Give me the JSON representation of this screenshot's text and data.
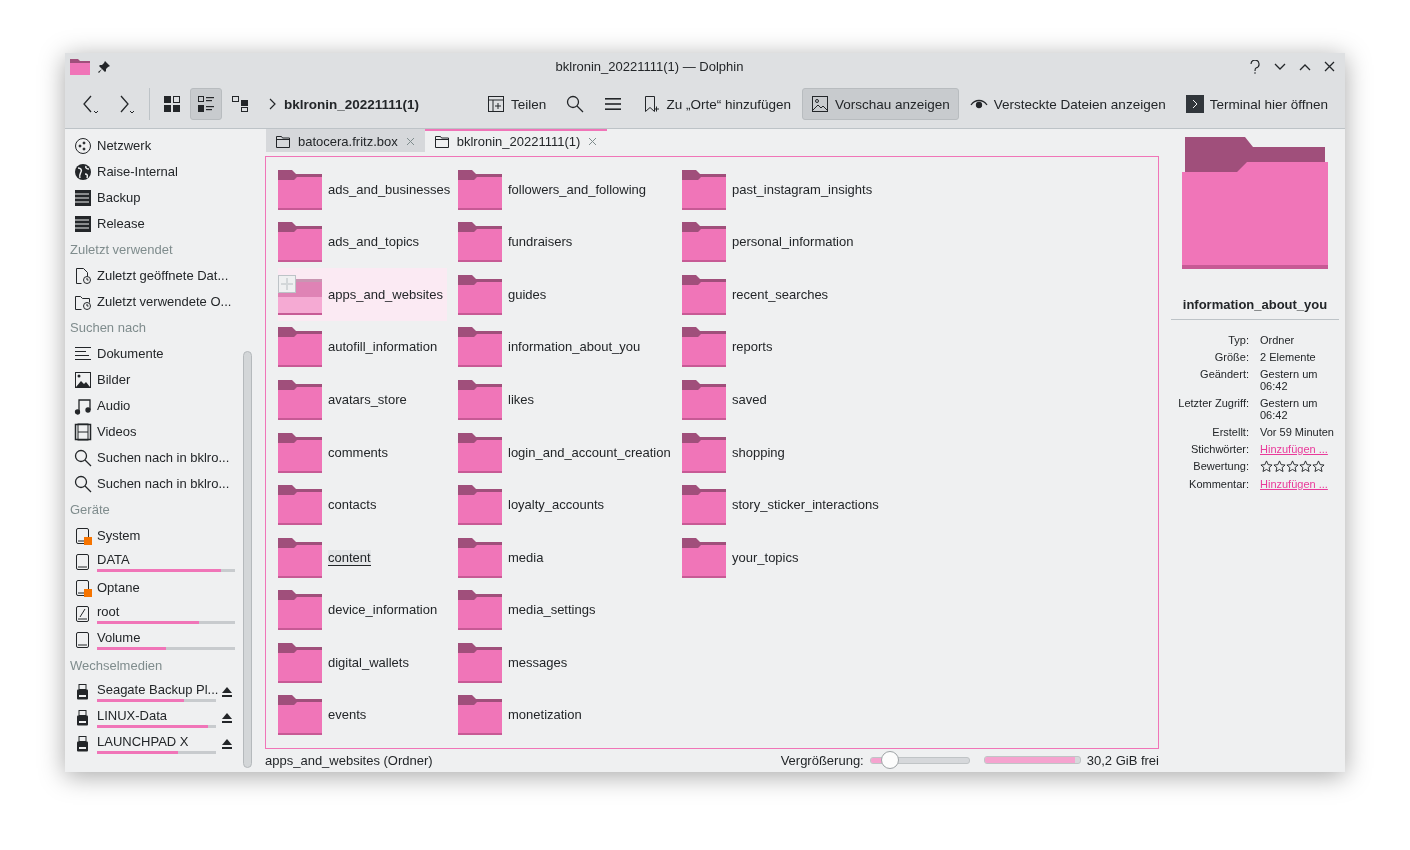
{
  "window": {
    "title": "bklronin_20221111(1) — Dolphin"
  },
  "toolbar": {
    "view_modes": [
      {
        "kind": "icons",
        "selected": false
      },
      {
        "kind": "compact",
        "selected": true
      },
      {
        "kind": "tree",
        "selected": false
      }
    ],
    "breadcrumb": "bklronin_20221111(1)",
    "actions": [
      {
        "kind": "share",
        "label": "Teilen"
      },
      {
        "kind": "search"
      },
      {
        "kind": "menu"
      },
      {
        "kind": "bookmark",
        "label": "Zu „Orte“ hinzufügen"
      },
      {
        "kind": "preview",
        "label": "Vorschau anzeigen",
        "checked": true
      },
      {
        "kind": "eye",
        "label": "Versteckte Dateien anzeigen",
        "checked": false
      },
      {
        "kind": "terminal",
        "label": "Terminal hier öffnen"
      }
    ]
  },
  "sidebar": {
    "sections": [
      {
        "items": [
          {
            "kind": "network",
            "label": "Netzwerk"
          },
          {
            "kind": "globe",
            "label": "Raise-Internal"
          },
          {
            "kind": "server",
            "label": "Backup"
          },
          {
            "kind": "server",
            "label": "Release"
          }
        ]
      },
      {
        "heading": "Zuletzt verwendet",
        "items": [
          {
            "kind": "recent-file",
            "label": "Zuletzt geöffnete Dat..."
          },
          {
            "kind": "recent-folder",
            "label": "Zuletzt verwendete O..."
          }
        ]
      },
      {
        "heading": "Suchen nach",
        "items": [
          {
            "kind": "document",
            "label": "Dokumente"
          },
          {
            "kind": "image",
            "label": "Bilder"
          },
          {
            "kind": "music",
            "label": "Audio"
          },
          {
            "kind": "film",
            "label": "Videos"
          },
          {
            "kind": "search",
            "label": "Suchen nach  in bklro..."
          },
          {
            "kind": "search",
            "label": "Suchen nach  in bklro..."
          }
        ]
      },
      {
        "heading": "Geräte",
        "items": [
          {
            "kind": "drive",
            "label": "System",
            "mounted": false
          },
          {
            "kind": "drive",
            "label": "DATA",
            "mounted": true,
            "level": 0.9
          },
          {
            "kind": "drive",
            "label": "Optane",
            "mounted": false
          },
          {
            "kind": "drive-root",
            "label": "root",
            "mounted": true,
            "level": 0.74
          },
          {
            "kind": "drive",
            "label": "Volume",
            "mounted": true,
            "level": 0.5
          }
        ]
      },
      {
        "heading": "Wechselmedien",
        "items": [
          {
            "kind": "usb",
            "label": "Seagate Backup Pl...",
            "level": 0.73,
            "ejectable": true
          },
          {
            "kind": "usb",
            "label": "LINUX-Data",
            "level": 0.93,
            "ejectable": true
          },
          {
            "kind": "usb",
            "label": "LAUNCHPAD X",
            "level": 0.68,
            "ejectable": true
          }
        ]
      }
    ]
  },
  "tabs": [
    {
      "label": "batocera.fritz.box",
      "selected": false
    },
    {
      "label": "bklronin_20221111(1)",
      "selected": true
    }
  ],
  "folders": [
    [
      {
        "name": "ads_and_businesses",
        "hovered": false,
        "focused": false
      },
      {
        "name": "ads_and_topics",
        "hovered": false,
        "focused": false
      },
      {
        "name": "apps_and_websites",
        "hovered": true,
        "focused": false
      },
      {
        "name": "autofill_information",
        "hovered": false,
        "focused": false
      },
      {
        "name": "avatars_store",
        "hovered": false,
        "focused": false
      },
      {
        "name": "comments",
        "hovered": false,
        "focused": false
      },
      {
        "name": "contacts",
        "hovered": false,
        "focused": false
      },
      {
        "name": "content",
        "hovered": false,
        "focused": true
      },
      {
        "name": "device_information",
        "hovered": false,
        "focused": false
      },
      {
        "name": "digital_wallets",
        "hovered": false,
        "focused": false
      },
      {
        "name": "events",
        "hovered": false,
        "focused": false
      }
    ],
    [
      {
        "name": "followers_and_following",
        "hovered": false,
        "focused": false
      },
      {
        "name": "fundraisers",
        "hovered": false,
        "focused": false
      },
      {
        "name": "guides",
        "hovered": false,
        "focused": false
      },
      {
        "name": "information_about_you",
        "hovered": false,
        "focused": false
      },
      {
        "name": "likes",
        "hovered": false,
        "focused": false
      },
      {
        "name": "login_and_account_creation",
        "hovered": false,
        "focused": false
      },
      {
        "name": "loyalty_accounts",
        "hovered": false,
        "focused": false
      },
      {
        "name": "media",
        "hovered": false,
        "focused": false
      },
      {
        "name": "media_settings",
        "hovered": false,
        "focused": false
      },
      {
        "name": "messages",
        "hovered": false,
        "focused": false
      },
      {
        "name": "monetization",
        "hovered": false,
        "focused": false
      }
    ],
    [
      {
        "name": "past_instagram_insights",
        "hovered": false,
        "focused": false
      },
      {
        "name": "personal_information",
        "hovered": false,
        "focused": false
      },
      {
        "name": "recent_searches",
        "hovered": false,
        "focused": false
      },
      {
        "name": "reports",
        "hovered": false,
        "focused": false
      },
      {
        "name": "saved",
        "hovered": false,
        "focused": false
      },
      {
        "name": "shopping",
        "hovered": false,
        "focused": false
      },
      {
        "name": "story_sticker_interactions",
        "hovered": false,
        "focused": false
      },
      {
        "name": "your_topics",
        "hovered": false,
        "focused": false
      }
    ]
  ],
  "info_panel": {
    "name": "information_about_you",
    "properties": [
      {
        "label": "Typ:",
        "kind": "text",
        "value": "Ordner"
      },
      {
        "label": "Größe:",
        "kind": "text",
        "value": "2 Elemente"
      },
      {
        "label": "Geändert:",
        "kind": "text",
        "value": "Gestern um 06:42"
      },
      {
        "label": "Letzter Zugriff:",
        "kind": "text",
        "value": "Gestern um 06:42"
      },
      {
        "label": "Erstellt:",
        "kind": "text",
        "value": "Vor 59 Minuten"
      },
      {
        "label": "Stichwörter:",
        "kind": "link",
        "value": "Hinzufügen ..."
      },
      {
        "label": "Bewertung:",
        "kind": "rating",
        "stars": 0
      },
      {
        "label": "Kommentar:",
        "kind": "link",
        "value": "Hinzufügen ..."
      }
    ]
  },
  "status_bar": {
    "text": "apps_and_websites (Ordner)",
    "zoom_label": "Vergrößerung:",
    "zoom": {
      "level": 0.2
    },
    "disk": {
      "level": 0.95
    },
    "free": "30,2 GiB frei"
  }
}
